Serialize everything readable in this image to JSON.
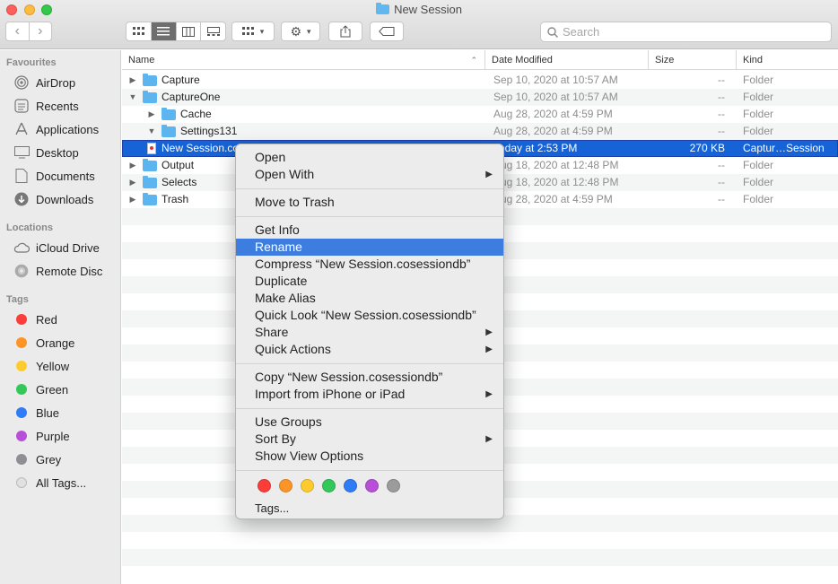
{
  "window": {
    "title": "New Session"
  },
  "toolbar": {
    "back": "‹",
    "forward": "›",
    "search_placeholder": "Search"
  },
  "sidebar": {
    "favourites_label": "Favourites",
    "favourites": [
      {
        "label": "AirDrop",
        "icon": "airdrop-icon"
      },
      {
        "label": "Recents",
        "icon": "recents-icon"
      },
      {
        "label": "Applications",
        "icon": "applications-icon"
      },
      {
        "label": "Desktop",
        "icon": "desktop-icon"
      },
      {
        "label": "Documents",
        "icon": "documents-icon"
      },
      {
        "label": "Downloads",
        "icon": "downloads-icon"
      }
    ],
    "locations_label": "Locations",
    "locations": [
      {
        "label": "iCloud Drive",
        "icon": "icloud-icon"
      },
      {
        "label": "Remote Disc",
        "icon": "disc-icon"
      }
    ],
    "tags_label": "Tags",
    "tags": [
      {
        "label": "Red",
        "color": "#fc3d39"
      },
      {
        "label": "Orange",
        "color": "#fd9426"
      },
      {
        "label": "Yellow",
        "color": "#fecb2e"
      },
      {
        "label": "Green",
        "color": "#34c759"
      },
      {
        "label": "Blue",
        "color": "#2f7cf6"
      },
      {
        "label": "Purple",
        "color": "#b84fd8"
      },
      {
        "label": "Grey",
        "color": "#8e8e93"
      },
      {
        "label": "All Tags...",
        "color": "#e0e0e0"
      }
    ]
  },
  "columns": {
    "name": "Name",
    "date": "Date Modified",
    "size": "Size",
    "kind": "Kind"
  },
  "files": [
    {
      "name": "Capture",
      "date": "Sep 10, 2020 at 10:57 AM",
      "size": "--",
      "kind": "Folder",
      "level": 0,
      "disclosure": "▶"
    },
    {
      "name": "CaptureOne",
      "date": "Sep 10, 2020 at 10:57 AM",
      "size": "--",
      "kind": "Folder",
      "level": 0,
      "disclosure": "▼"
    },
    {
      "name": "Cache",
      "date": "Aug 28, 2020 at 4:59 PM",
      "size": "--",
      "kind": "Folder",
      "level": 1,
      "disclosure": "▶"
    },
    {
      "name": "Settings131",
      "date": "Aug 28, 2020 at 4:59 PM",
      "size": "--",
      "kind": "Folder",
      "level": 1,
      "disclosure": "▼"
    },
    {
      "name": "New Session.cosessiondb",
      "date": "Today at 2:53 PM",
      "size": "270 KB",
      "kind": "Captur…Session",
      "level": 0,
      "disclosure": ""
    },
    {
      "name": "Output",
      "date": "Aug 18, 2020 at 12:48 PM",
      "size": "--",
      "kind": "Folder",
      "level": 0,
      "disclosure": "▶"
    },
    {
      "name": "Selects",
      "date": "Aug 18, 2020 at 12:48 PM",
      "size": "--",
      "kind": "Folder",
      "level": 0,
      "disclosure": "▶"
    },
    {
      "name": "Trash",
      "date": "Aug 28, 2020 at 4:59 PM",
      "size": "--",
      "kind": "Folder",
      "level": 0,
      "disclosure": "▶"
    }
  ],
  "context_menu": {
    "items": [
      {
        "label": "Open"
      },
      {
        "label": "Open With",
        "submenu": true
      },
      {
        "label": "Move to Trash"
      },
      {
        "label": "Get Info"
      },
      {
        "label": "Rename",
        "highlighted": true
      },
      {
        "label": "Compress “New Session.cosessiondb”"
      },
      {
        "label": "Duplicate"
      },
      {
        "label": "Make Alias"
      },
      {
        "label": "Quick Look “New Session.cosessiondb”"
      },
      {
        "label": "Share",
        "submenu": true
      },
      {
        "label": "Quick Actions",
        "submenu": true
      },
      {
        "label": "Copy “New Session.cosessiondb”"
      },
      {
        "label": "Import from iPhone or iPad",
        "submenu": true
      },
      {
        "label": "Use Groups"
      },
      {
        "label": "Sort By",
        "submenu": true
      },
      {
        "label": "Show View Options"
      }
    ],
    "tag_colors": [
      "#fc3d39",
      "#fd9426",
      "#fecb2e",
      "#34c759",
      "#2f7cf6",
      "#b84fd8",
      "#9b9b9b"
    ],
    "tags_label": "Tags..."
  }
}
